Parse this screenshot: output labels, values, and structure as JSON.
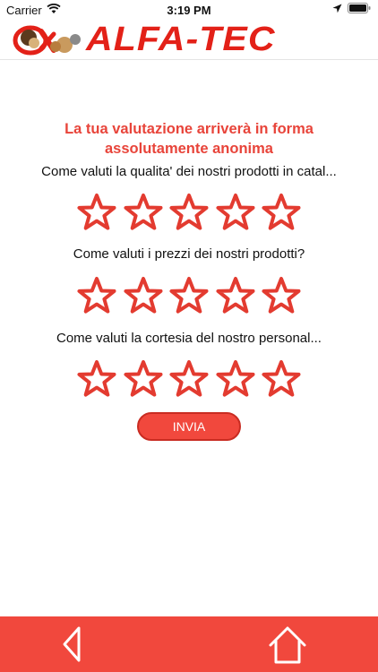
{
  "status_bar": {
    "carrier": "Carrier",
    "time": "3:19 PM"
  },
  "header": {
    "brand": "ALFA-TEC"
  },
  "intro": {
    "line1": "La tua valutazione arriverà in forma",
    "line2": "assolutamente anonima"
  },
  "questions": [
    {
      "text": "Come valuti la qualita' dei nostri prodotti in catal...",
      "rating": 0,
      "max": 5
    },
    {
      "text": "Come valuti i prezzi dei nostri prodotti?",
      "rating": 0,
      "max": 5
    },
    {
      "text": "Come valuti la cortesia del nostro personal...",
      "rating": 0,
      "max": 5
    }
  ],
  "submit_label": "INVIA",
  "colors": {
    "accent": "#f1483d",
    "brand_red": "#e32118",
    "star_stroke": "#e33b30"
  },
  "icons": {
    "back": "chevron-left-icon",
    "home": "home-icon"
  }
}
